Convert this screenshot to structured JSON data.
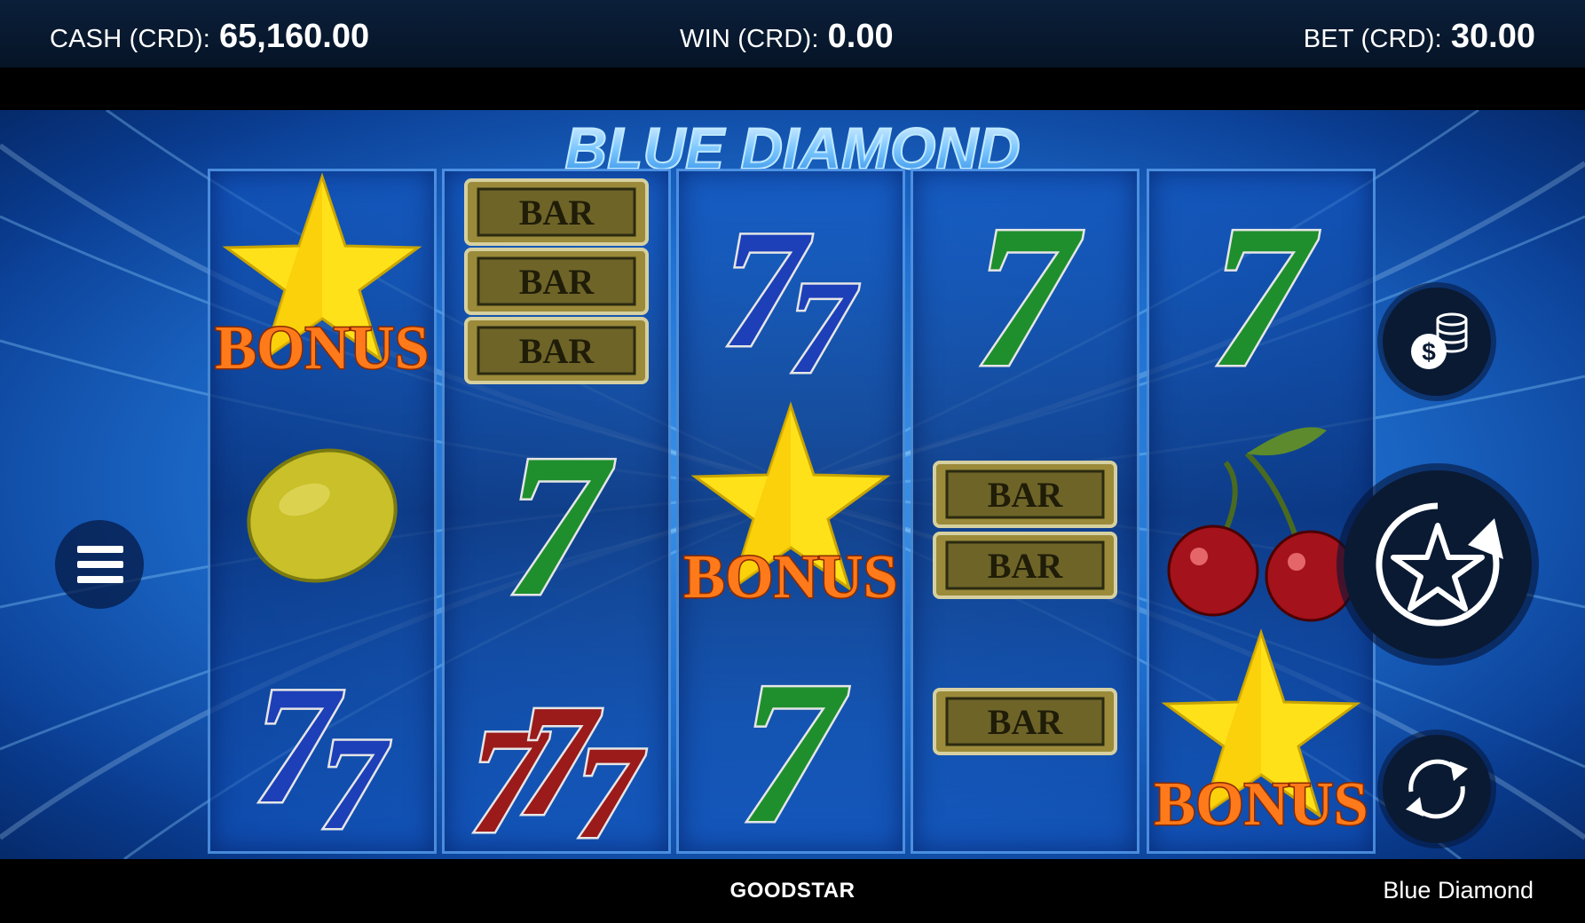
{
  "topbar": {
    "cash_label": "CASH (CRD):",
    "cash_value": "65,160.00",
    "win_label": "WIN (CRD):",
    "win_value": "0.00",
    "bet_label": "BET (CRD):",
    "bet_value": "30.00"
  },
  "game": {
    "logo_text": "BLUE DIAMOND",
    "reels": [
      [
        "star-bonus",
        "lemon",
        "double-blue-seven"
      ],
      [
        "triple-bar",
        "green-seven",
        "triple-red-seven"
      ],
      [
        "double-blue-seven",
        "star-bonus",
        "green-seven"
      ],
      [
        "green-seven",
        "double-bar",
        "single-bar"
      ],
      [
        "green-seven",
        "cherries",
        "star-bonus"
      ]
    ],
    "bonus_text": "BONUS",
    "bar_text": "BAR",
    "seven_text": "7"
  },
  "controls": {
    "menu_icon": "hamburger-menu-icon",
    "coins_icon": "coins-dollar-icon",
    "spin_icon": "star-spin-icon",
    "autoplay_icon": "autoplay-arrows-icon"
  },
  "footer": {
    "brand": "GOODSTAR",
    "game_name": "Blue Diamond"
  },
  "colors": {
    "background_blue": "#0f5fc6",
    "seven_green": "#1f8f2e",
    "seven_blue": "#1d3fb8",
    "seven_red": "#9b1a1a",
    "bonus_orange": "#ff7a1a",
    "star_yellow": "#ffe11a",
    "bar_gold": "#9a8a3a"
  }
}
